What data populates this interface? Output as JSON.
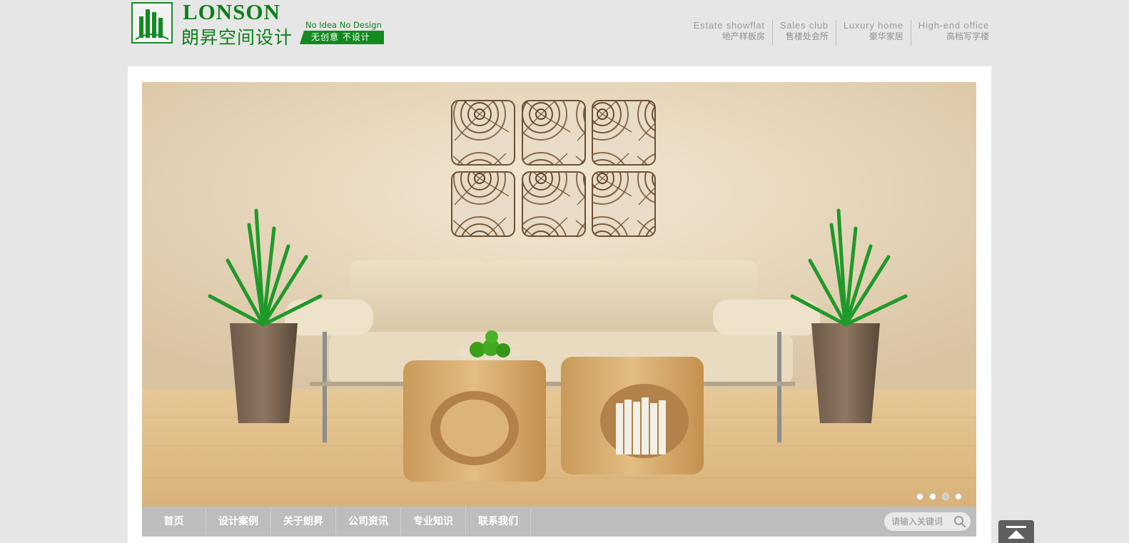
{
  "brand": {
    "name_en": "LONSON",
    "name_cn": "朗昇空间设计",
    "slogan_en": "No Idea No Design",
    "slogan_cn": "无创意  不设计",
    "color": "#0e7f1b"
  },
  "top_nav": [
    {
      "en": "Estate showflat",
      "cn": "地产样板房"
    },
    {
      "en": "Sales club",
      "cn": "售楼处会所"
    },
    {
      "en": "Luxury home",
      "cn": "豪华家居"
    },
    {
      "en": "High-end office",
      "cn": "高档写字楼"
    }
  ],
  "banner": {
    "image": "living-room-with-sofa-plants-and-wood-wall-art",
    "slides": 4,
    "active_slide": 3
  },
  "main_nav": [
    "首页",
    "设计案例",
    "关于朗昇",
    "公司资讯",
    "专业知识",
    "联系我们"
  ],
  "search": {
    "placeholder": "请输入关键词",
    "icon": "search-icon"
  },
  "back_to_top": {
    "icon": "arrow-up-icon"
  }
}
